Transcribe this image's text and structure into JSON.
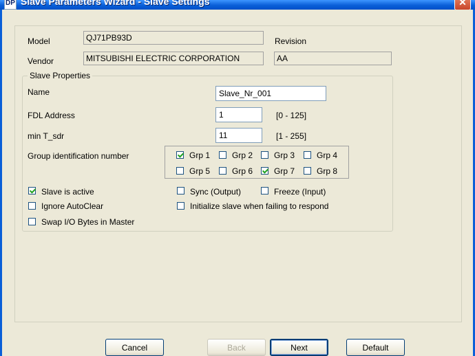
{
  "window": {
    "title": "Slave Parameters Wizard - Slave Settings",
    "app_icon": "DP",
    "close_icon": "close-icon"
  },
  "info": {
    "model_label": "Model",
    "model_value": "QJ71PB93D",
    "vendor_label": "Vendor",
    "vendor_value": "MITSUBISHI ELECTRIC CORPORATION",
    "revision_label": "Revision",
    "revision_value": "AA"
  },
  "slave_properties": {
    "title": "Slave Properties",
    "name_label": "Name",
    "name_value": "Slave_Nr_001",
    "fdl_label": "FDL Address",
    "fdl_value": "1",
    "fdl_range": "[0 - 125]",
    "tsdr_label": "min T_sdr",
    "tsdr_value": "11",
    "tsdr_range": "[1 - 255]",
    "group_label": "Group identification number",
    "groups": [
      {
        "label": "Grp 1",
        "checked": true
      },
      {
        "label": "Grp 2",
        "checked": false
      },
      {
        "label": "Grp 3",
        "checked": false
      },
      {
        "label": "Grp 4",
        "checked": false
      },
      {
        "label": "Grp 5",
        "checked": false
      },
      {
        "label": "Grp 6",
        "checked": false
      },
      {
        "label": "Grp 7",
        "checked": true
      },
      {
        "label": "Grp 8",
        "checked": false
      }
    ],
    "options": {
      "slave_active": {
        "label": "Slave is active",
        "checked": true
      },
      "sync_output": {
        "label": "Sync (Output)",
        "checked": false
      },
      "freeze_input": {
        "label": "Freeze (Input)",
        "checked": false
      },
      "ignore_autoclear": {
        "label": "Ignore AutoClear",
        "checked": false
      },
      "init_slave": {
        "label": "Initialize slave when failing to respond",
        "checked": false
      },
      "swap_io": {
        "label": "Swap I/O Bytes in Master",
        "checked": false
      }
    }
  },
  "buttons": {
    "cancel": "Cancel",
    "back": "Back",
    "next": "Next",
    "default": "Default"
  }
}
